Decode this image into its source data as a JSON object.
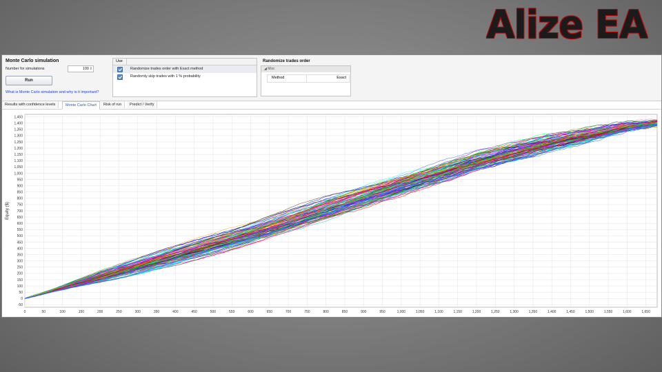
{
  "logo": {
    "text": "Alize EA"
  },
  "simulation": {
    "title": "Monte Carlo simulation",
    "count_label": "Number for simulations",
    "count_value": "100",
    "run_label": "Run",
    "help_link": "What is Monte Carlo simulation and why is it important?"
  },
  "options": {
    "header": "Use",
    "rows": [
      {
        "checked": true,
        "label": "Randomize trades order with Exact method"
      },
      {
        "checked": true,
        "label": "Randomly skip trades with 1 % probability"
      }
    ]
  },
  "randomize": {
    "title": "Randomize trades order",
    "section": "Misc",
    "key": "Method",
    "value": "Exact"
  },
  "tabs": [
    {
      "label": "Results with confidence levels",
      "active": false
    },
    {
      "label": "Monte Carlo Chart",
      "active": true
    },
    {
      "label": "Risk of run",
      "active": false
    },
    {
      "label": "Predict / Verify",
      "active": false
    }
  ],
  "chart_data": {
    "type": "line",
    "title": "",
    "xlabel": "",
    "ylabel": "Equity ($)",
    "xlim": [
      0,
      1680
    ],
    "ylim": [
      -70,
      1470
    ],
    "x_ticks": [
      0,
      50,
      100,
      150,
      200,
      250,
      300,
      350,
      400,
      450,
      500,
      550,
      600,
      650,
      700,
      750,
      800,
      850,
      900,
      950,
      1000,
      1050,
      1100,
      1150,
      1200,
      1250,
      1300,
      1350,
      1400,
      1450,
      1500,
      1550,
      1600,
      1650
    ],
    "y_ticks": [
      -50,
      0,
      50,
      100,
      150,
      200,
      250,
      300,
      350,
      400,
      450,
      500,
      550,
      600,
      650,
      700,
      750,
      800,
      850,
      900,
      950,
      1000,
      1050,
      1100,
      1150,
      1200,
      1250,
      1300,
      1350,
      1400,
      1450
    ],
    "grid": true,
    "legend": "none",
    "simulations": 100,
    "trades": 1680,
    "start_equity": 0,
    "end_equity_range": [
      1380,
      1420
    ],
    "envelope": {
      "x": [
        0,
        200,
        400,
        600,
        800,
        1000,
        1200,
        1400,
        1600,
        1680
      ],
      "upper": [
        20,
        250,
        430,
        610,
        820,
        1000,
        1180,
        1320,
        1410,
        1420
      ],
      "lower": [
        -20,
        100,
        260,
        430,
        620,
        820,
        1020,
        1180,
        1330,
        1380
      ]
    },
    "palette": [
      "#ff0000",
      "#00aa00",
      "#0000ff",
      "#ff00ff",
      "#00cccc",
      "#ffaa00",
      "#8800cc",
      "#00ff66",
      "#cc0066",
      "#3366ff",
      "#999900",
      "#ff6699",
      "#006600",
      "#663300",
      "#00ffff"
    ]
  }
}
